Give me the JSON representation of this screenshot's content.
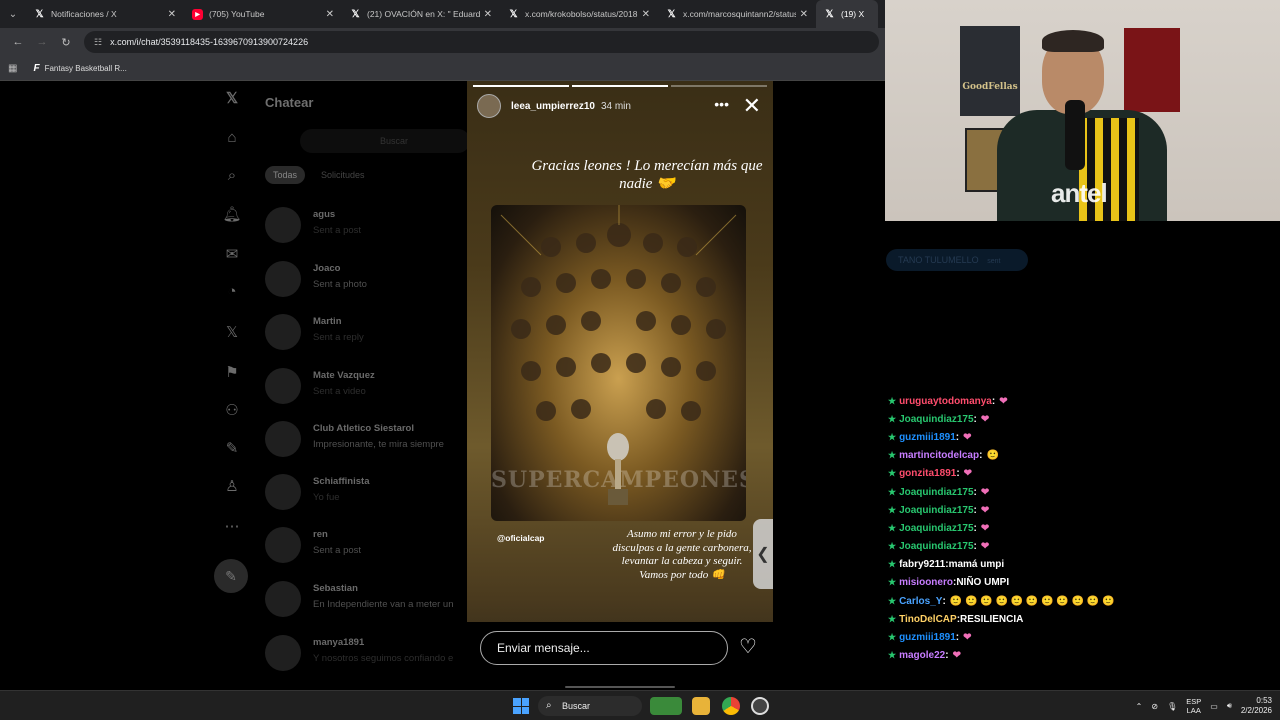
{
  "browser": {
    "tabs": [
      {
        "label": "Notificaciones / X",
        "icon": "x-logo-icon"
      },
      {
        "label": "(705) YouTube",
        "icon": "youtube-icon"
      },
      {
        "label": "(21) OVACIÓN en X: \" Eduardo",
        "icon": "x-logo-icon"
      },
      {
        "label": "x.com/krokobolso/status/2018",
        "icon": "x-logo-icon"
      },
      {
        "label": "x.com/marcosquintann2/status",
        "icon": "x-logo-icon"
      },
      {
        "label": "(19) X",
        "icon": "x-logo-icon"
      }
    ],
    "url": "x.com/i/chat/3539118435-1639670913900724226",
    "bookmark": "Fantasy Basketball R..."
  },
  "x_chat": {
    "title": "Chatear",
    "search_placeholder": "Buscar",
    "filters": [
      "Todas",
      "Solicitudes"
    ],
    "conversations": [
      {
        "name": "agus",
        "preview": "Sent a post"
      },
      {
        "name": "Joaco",
        "preview": "Sent a photo"
      },
      {
        "name": "Martin",
        "preview": "Sent a reply"
      },
      {
        "name": "Mate Vazquez",
        "preview": "Sent a video"
      },
      {
        "name": "Club Atletico Siestarol",
        "preview": "Impresionante, te mira siempre"
      },
      {
        "name": "Schiaffinista",
        "preview": "Yo fue"
      },
      {
        "name": "ren",
        "preview": "Sent a post"
      },
      {
        "name": "Sebastian",
        "preview": "En Independiente van a meter un"
      },
      {
        "name": "manya1891",
        "preview": "Y nosotros seguimos confiando e"
      }
    ]
  },
  "story": {
    "username": "leea_umpierrez10",
    "time": "34 min",
    "caption_top": "Gracias leones ! Lo merecían más que nadie 🤝",
    "poster_title": "SUPERCAMPEONES",
    "handle": "@oficialcap",
    "caption_bottom": "Asumo mi error y le pido disculpas a la gente carbonera, levantar la cabeza y seguir. Vamos por todo 👊",
    "message_placeholder": "Enviar mensaje..."
  },
  "overlay": {
    "pill_text": "TANO TULUMELLO",
    "pill_sub": "sent"
  },
  "stream_chat": [
    {
      "user": "uruguaytodomanya",
      "msg": "",
      "color": "#ff4d6d",
      "emote": "❤"
    },
    {
      "user": "Joaquindiaz175",
      "msg": "",
      "color": "#28c76f",
      "emote": "❤"
    },
    {
      "user": "guzmiii1891",
      "msg": "",
      "color": "#1e90ff",
      "emote": "❤"
    },
    {
      "user": "martincitodelcap",
      "msg": "",
      "color": "#c77dff",
      "emote": "🙂"
    },
    {
      "user": "gonzita1891",
      "msg": "",
      "color": "#ff4d6d",
      "emote": "❤"
    },
    {
      "user": "Joaquindiaz175",
      "msg": "",
      "color": "#28c76f",
      "emote": "❤"
    },
    {
      "user": "Joaquindiaz175",
      "msg": "",
      "color": "#28c76f",
      "emote": "❤"
    },
    {
      "user": "Joaquindiaz175",
      "msg": "",
      "color": "#28c76f",
      "emote": "❤"
    },
    {
      "user": "Joaquindiaz175",
      "msg": "",
      "color": "#28c76f",
      "emote": "❤"
    },
    {
      "user": "fabry9211",
      "msg": "mamá umpi",
      "color": "#ffffff",
      "emote": ""
    },
    {
      "user": "misioonero",
      "msg": "NIÑO UMPI",
      "color": "#c77dff",
      "emote": ""
    },
    {
      "user": "Carlos_Y",
      "msg": "",
      "color": "#4aa3ff",
      "emote": "🙂 🙂 🙂 🙂 🙂 🙂 🙂 🙂 🙂 🙂 🙂"
    },
    {
      "user": "TinoDelCAP",
      "msg": "RESILIENCIA",
      "color": "#ffd166",
      "emote": ""
    },
    {
      "user": "guzmiii1891",
      "msg": "",
      "color": "#1e90ff",
      "emote": "❤"
    },
    {
      "user": "magole22",
      "msg": "",
      "color": "#c77dff",
      "emote": "❤"
    }
  ],
  "taskbar": {
    "search": "Buscar",
    "lang_1": "ESP",
    "lang_2": "LAA",
    "time": "0:53",
    "date": "2/2/2026"
  },
  "colors": {
    "accent": "#1d9bf0",
    "story_gold": "#c9a04e"
  }
}
